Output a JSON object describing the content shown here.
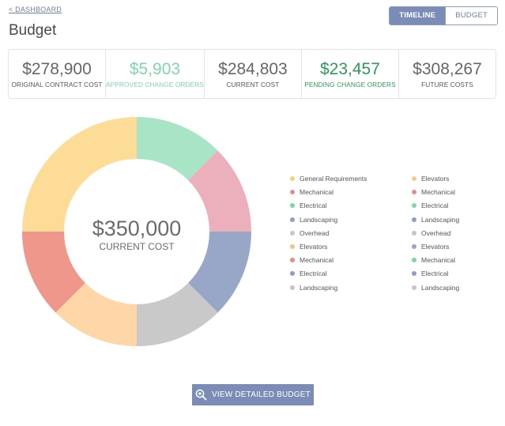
{
  "nav": {
    "breadcrumb": "< DASHBOARD",
    "title": "Budget"
  },
  "view_toggle": {
    "active": "TIMELINE",
    "inactive": "BUDGET"
  },
  "stats": [
    {
      "value": "$278,900",
      "label": "ORIGINAL CONTRACT COST",
      "color": "#666666"
    },
    {
      "value": "$5,903",
      "label": "APPROVED CHANGE ORDERS",
      "color": "#7fd6ab"
    },
    {
      "value": "$284,803",
      "label": "CURRENT COST",
      "color": "#666666"
    },
    {
      "value": "$23,457",
      "label": "PENDING CHANGE ORDERS",
      "color": "#2e9a5a"
    },
    {
      "value": "$308,267",
      "label": "FUTURE COSTS",
      "color": "#666666"
    }
  ],
  "chart_data": {
    "type": "pie",
    "variant": "donut",
    "center_value": "$350,000",
    "center_label": "CURRENT COST",
    "slices": [
      {
        "color": "#a8e5c7",
        "fraction": 0.125
      },
      {
        "color": "#ecb0bd",
        "fraction": 0.125
      },
      {
        "color": "#98a6c7",
        "fraction": 0.125
      },
      {
        "color": "#c9c9c9",
        "fraction": 0.125
      },
      {
        "color": "#fed6a7",
        "fraction": 0.125
      },
      {
        "color": "#f0978c",
        "fraction": 0.125
      },
      {
        "color": "#fddc98",
        "fraction": 0.25
      }
    ],
    "legend": [
      {
        "label": "General Requirements",
        "color": "#f6cf7d"
      },
      {
        "label": "Mechanical",
        "color": "#e48c96"
      },
      {
        "label": "Electrical",
        "color": "#7fd6a3"
      },
      {
        "label": "Landscaping",
        "color": "#8e9fc2"
      },
      {
        "label": "Overhead",
        "color": "#c6c6c6"
      },
      {
        "label": "Elevators",
        "color": "#f9c188"
      },
      {
        "label": "Mechanical",
        "color": "#ec8a80"
      },
      {
        "label": "Electrical",
        "color": "#8e9fc2"
      },
      {
        "label": "Landscaping",
        "color": "#c6c6c6"
      },
      {
        "label": "Elevators",
        "color": "#f6cf7d"
      },
      {
        "label": "Mechanical",
        "color": "#e48c96"
      },
      {
        "label": "Electrical",
        "color": "#7fd6a3"
      },
      {
        "label": "Landscaping",
        "color": "#8e9fc2"
      },
      {
        "label": "Overhead",
        "color": "#c6c6c6"
      },
      {
        "label": "Elevators",
        "color": "#98a6c7"
      },
      {
        "label": "Mechanical",
        "color": "#7fd6a3"
      },
      {
        "label": "Electrical",
        "color": "#8e9fc2"
      },
      {
        "label": "Landscaping",
        "color": "#c6c6c6"
      }
    ]
  },
  "cta": {
    "label": "VIEW DETAILED BUDGET",
    "icon": "zoom-in-icon"
  }
}
